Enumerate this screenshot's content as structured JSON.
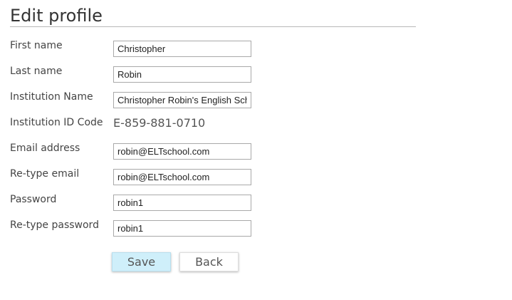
{
  "page": {
    "title": "Edit profile"
  },
  "form": {
    "first_name": {
      "label": "First name",
      "value": "Christopher"
    },
    "last_name": {
      "label": "Last name",
      "value": "Robin"
    },
    "institution_name": {
      "label": "Institution Name",
      "value": "Christopher Robin's English School"
    },
    "institution_id": {
      "label": "Institution ID Code",
      "value": "E-859-881-0710"
    },
    "email": {
      "label": "Email address",
      "value": "robin@ELTschool.com"
    },
    "retype_email": {
      "label": "Re-type email",
      "value": "robin@ELTschool.com"
    },
    "password": {
      "label": "Password",
      "value": "robin1"
    },
    "retype_password": {
      "label": "Re-type password",
      "value": "robin1"
    }
  },
  "actions": {
    "save_label": "Save",
    "back_label": "Back"
  },
  "colors": {
    "save_button_bg": "#cfeffa",
    "back_button_bg": "#ffffff",
    "title_rule": "#b9b9b9"
  }
}
